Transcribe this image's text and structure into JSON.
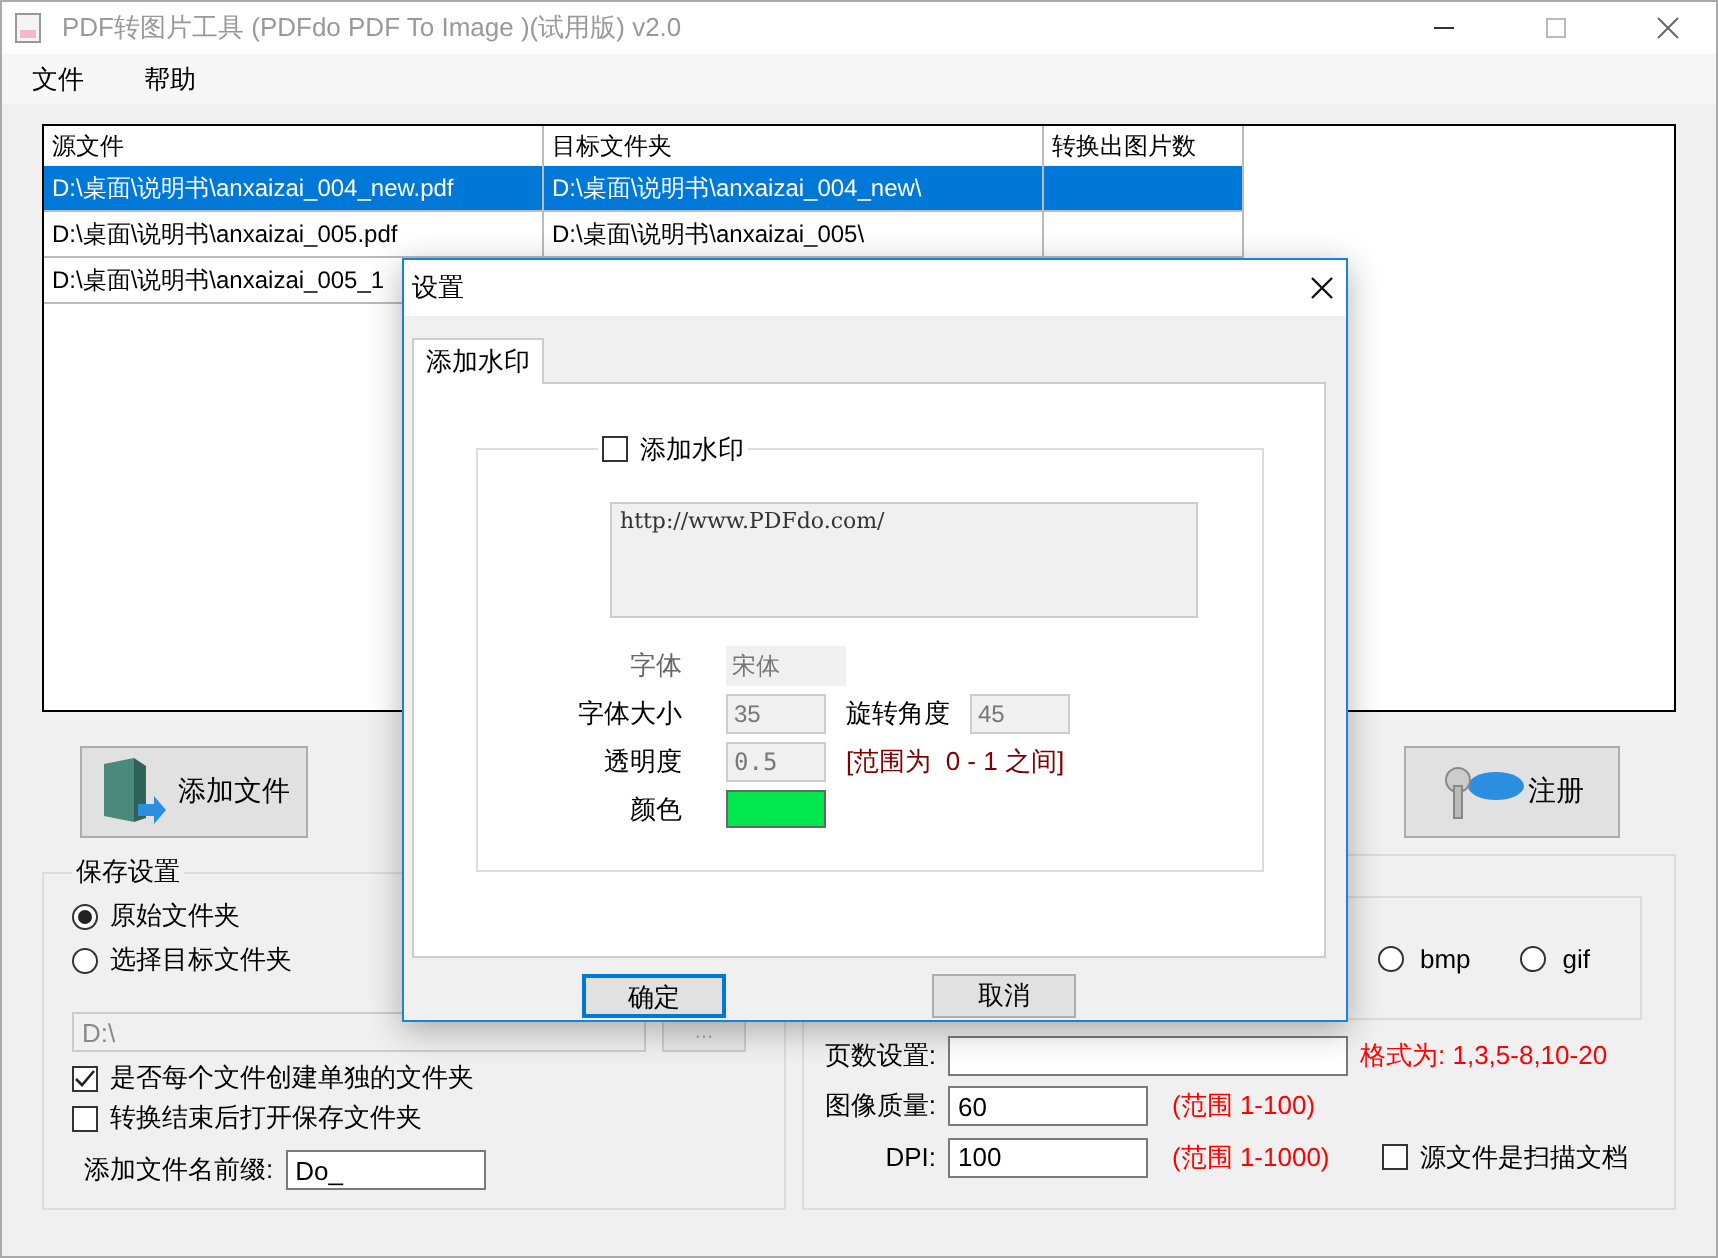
{
  "window": {
    "title": "PDF转图片工具 (PDFdo PDF To Image )(试用版) v2.0"
  },
  "menu": [
    "文件",
    "帮助"
  ],
  "table": {
    "columns": [
      "源文件",
      "目标文件夹",
      "转换出图片数"
    ],
    "rows": [
      {
        "source": "D:\\桌面\\说明书\\anxaizai_004_new.pdf",
        "target": "D:\\桌面\\说明书\\anxaizai_004_new\\",
        "selected": true
      },
      {
        "source": "D:\\桌面\\说明书\\anxaizai_005.pdf",
        "target": "D:\\桌面\\说明书\\anxaizai_005\\",
        "selected": false
      },
      {
        "source": "D:\\桌面\\说明书\\anxaizai_005_1",
        "selected": false
      }
    ]
  },
  "add_file_button": "添加文件",
  "register_button": "注册",
  "save_settings": {
    "title": "保存设置",
    "radios": [
      {
        "label": "原始文件夹",
        "selected": true
      },
      {
        "label": "选择目标文件夹",
        "selected": false
      }
    ],
    "path_field": {
      "value": "D:\\",
      "disabled": true
    },
    "browse_button": {
      "label": "...",
      "disabled": true
    },
    "checkboxes": [
      {
        "label": "是否每个文件创建单独的文件夹",
        "checked": true
      },
      {
        "label": "转换结束后打开保存文件夹",
        "checked": false
      }
    ],
    "prefix": {
      "label": "添加文件名前缀:",
      "value": "Do_"
    }
  },
  "output_format": {
    "options": [
      {
        "label": "bmp",
        "selected": false
      },
      {
        "label": "gif",
        "selected": false
      }
    ]
  },
  "page_settings": {
    "label": "页数设置:",
    "hint": "格式为: 1,3,5-8,10-20"
  },
  "quality": {
    "label": "图像质量:",
    "value": "60",
    "hint": "(范围 1-100)"
  },
  "dpi": {
    "label": "DPI:",
    "value": "100",
    "hint": "(范围 1-1000)"
  },
  "scanned_checkbox": {
    "label": "源文件是扫描文档",
    "checked": false
  },
  "dialog": {
    "title": "设置",
    "tabs": [
      {
        "label": "添加水印",
        "selected": true
      }
    ],
    "watermark_checkbox": {
      "label": "添加水印",
      "checked": false
    },
    "watermark_text": "http://www.PDFdo.com/",
    "font": {
      "label": "字体",
      "value": "宋体"
    },
    "font_size": {
      "label": "字体大小",
      "value": "35"
    },
    "rotation": {
      "label": "旋转角度",
      "value": "45"
    },
    "opacity": {
      "label": "透明度",
      "value": "0.5",
      "hint": "[范围为  0 - 1 之间]"
    },
    "color": {
      "label": "颜色",
      "color": "#00e64f"
    },
    "ok_button": "确定",
    "cancel_button": "取消"
  }
}
